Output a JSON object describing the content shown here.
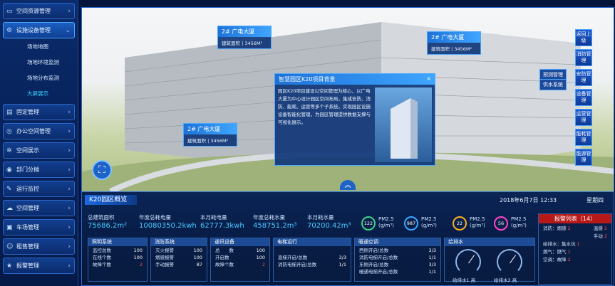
{
  "sidebar": {
    "items": [
      {
        "label": "空间资源管理",
        "icon": "monitor-icon",
        "glyph": "▭",
        "chev": "›"
      },
      {
        "label": "设施设备管理",
        "icon": "gear-icon",
        "glyph": "⚙",
        "chev": "⌄",
        "active": true
      },
      {
        "label": "固定管理",
        "icon": "folder-icon",
        "glyph": "▤",
        "chev": "›"
      },
      {
        "label": "办公空间管理",
        "icon": "chair-icon",
        "glyph": "◎",
        "chev": "›"
      },
      {
        "label": "空间展示",
        "icon": "grid-icon",
        "glyph": "✲",
        "chev": "›"
      },
      {
        "label": "部门分摊",
        "icon": "share-icon",
        "glyph": "◉",
        "chev": "›"
      },
      {
        "label": "运行监控",
        "icon": "wrench-icon",
        "glyph": "✎",
        "chev": "›"
      },
      {
        "label": "空间管理",
        "icon": "cloud-icon",
        "glyph": "☁",
        "chev": "›"
      },
      {
        "label": "车场管理",
        "icon": "car-icon",
        "glyph": "▣",
        "chev": "›"
      },
      {
        "label": "租售管理",
        "icon": "user-icon",
        "glyph": "☺",
        "chev": "›"
      },
      {
        "label": "报警管理",
        "icon": "star-icon",
        "glyph": "★",
        "chev": "›"
      }
    ],
    "subitems": [
      "场地地图",
      "场地环境监测",
      "场地分布监测",
      "大屏展示"
    ]
  },
  "popups": {
    "p1": {
      "title": "2# 广电大厦",
      "body": "建筑面积 | 3456M²"
    },
    "p2": {
      "title": "2# 广电大厦",
      "body": "建筑面积 | 3456M²"
    },
    "p3": {
      "title": "2# 广电大厦",
      "body": "建筑面积 | 3456M²"
    },
    "project": {
      "title": "智慧园区K20项目背景",
      "close": "×",
      "text": "园区K20项目建设以空间管理为核心，以广电大厦为中心设计园区空间布局，集成安防、消防、能耗、运营等多个子系统，实现园区设施设备智能化管理，为园区管理提供数据支撑与可视化展示。"
    }
  },
  "right_buttons": [
    "返回上级",
    "消防管理",
    "安防管理",
    "设备管理",
    "运营管理",
    "能耗管理",
    "能源管理"
  ],
  "right_labels": [
    "预测管理",
    "供水系统"
  ],
  "bottom": {
    "title": "K20园区概览",
    "datetime": "2018年6月7日  12:33",
    "weekday": "星期四",
    "stats": [
      {
        "label": "总建筑面积",
        "value": "75686.2m²"
      },
      {
        "label": "年度总耗电量",
        "value": "10080350.2kwh"
      },
      {
        "label": "本月耗电量",
        "value": "62777.3kwh"
      },
      {
        "label": "年度总耗水量",
        "value": "458751.2m³"
      },
      {
        "label": "本月耗水量",
        "value": "70200.42m³"
      }
    ],
    "pm": [
      {
        "value": "122",
        "label": "PM2.5",
        "unit": "(g/m³)",
        "color": "#3ad28a"
      },
      {
        "value": "987",
        "label": "PM2.5",
        "unit": "(g/m³)",
        "color": "#3aa8ff"
      },
      {
        "value": "22",
        "label": "PM2.5",
        "unit": "(g/m³)",
        "color": "#ffb020"
      },
      {
        "value": "56",
        "label": "PM2.5",
        "unit": "(g/m³)",
        "color": "#ff46c8"
      }
    ],
    "boxes": [
      {
        "title": "照明系统",
        "rows": [
          [
            "监控总数",
            "100"
          ],
          [
            "在线个数",
            "100"
          ],
          [
            "故障个数",
            "2"
          ]
        ]
      },
      {
        "title": "消防系统",
        "rows": [
          [
            "灭火报警",
            "100"
          ],
          [
            "烟感报警",
            "100"
          ],
          [
            "手动报警",
            "87"
          ]
        ]
      },
      {
        "title": "通讯设备",
        "rows": [
          [
            "总　　数",
            "100"
          ],
          [
            "开启数",
            "100"
          ],
          [
            "故障个数",
            "2"
          ]
        ]
      },
      {
        "title": "电梯运行",
        "rows": [
          [
            "直梯开启/总数",
            "3/3"
          ],
          [
            "消防电梯开启/总数",
            "1/1"
          ]
        ]
      },
      {
        "title": "暖通空调",
        "rows": [
          [
            "西侧开启/总数",
            "3/3"
          ],
          [
            "消防电梯开启/总数",
            "1/1"
          ],
          [
            "东侧开启/总数",
            "3/3"
          ],
          [
            "暖通电梯开启/总数",
            "1/1"
          ]
        ]
      },
      {
        "title": "给排水",
        "rows": []
      }
    ],
    "gauges": [
      "给排水1 高",
      "给排水2 高"
    ],
    "alarm": {
      "title": "报警列表（14）",
      "rows": [
        [
          "消防：烟感",
          "2",
          "温感",
          "2"
        ],
        [
          "手动",
          "2",
          "",
          ""
        ],
        [
          "给排水：集水坑",
          "1",
          "",
          ""
        ],
        [
          "燃气：燃气",
          "1",
          "",
          ""
        ],
        [
          "空调：故障",
          "2",
          "",
          ""
        ]
      ]
    }
  }
}
